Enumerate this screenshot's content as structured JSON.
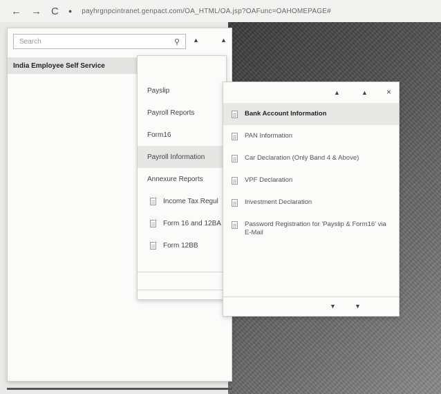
{
  "browser": {
    "back": "←",
    "forward": "→",
    "reload": "C",
    "lock": "●",
    "url": "payhrgnpcintranet.genpact.com/OA_HTML/OA.jsp?OAFunc=OAHOMEPAGE#"
  },
  "search": {
    "placeholder": "Search",
    "icon": "search-icon"
  },
  "panel_controls": {
    "up": "▲",
    "close": "×",
    "down": "▼"
  },
  "left_menu": {
    "selected": "India Employee Self Service"
  },
  "menu2": {
    "items": [
      {
        "label": "Payslip"
      },
      {
        "label": "Payroll Reports"
      },
      {
        "label": "Form16"
      },
      {
        "label": "Payroll Information",
        "active": true
      },
      {
        "label": "Annexure Reports"
      }
    ],
    "subitems": [
      {
        "label": "Income Tax Regul"
      },
      {
        "label": "Form 16 and 12BA"
      },
      {
        "label": "Form 12BB"
      }
    ]
  },
  "menu3": {
    "items": [
      {
        "label": "Bank Account Information",
        "active": true
      },
      {
        "label": "PAN Information"
      },
      {
        "label": "Car Declaration (Only Band 4 & Above)"
      },
      {
        "label": "VPF Declaration"
      },
      {
        "label": "Investment Declaration"
      },
      {
        "label": "Password Registration for 'Payslip & Form16' via E-Mail"
      }
    ]
  }
}
